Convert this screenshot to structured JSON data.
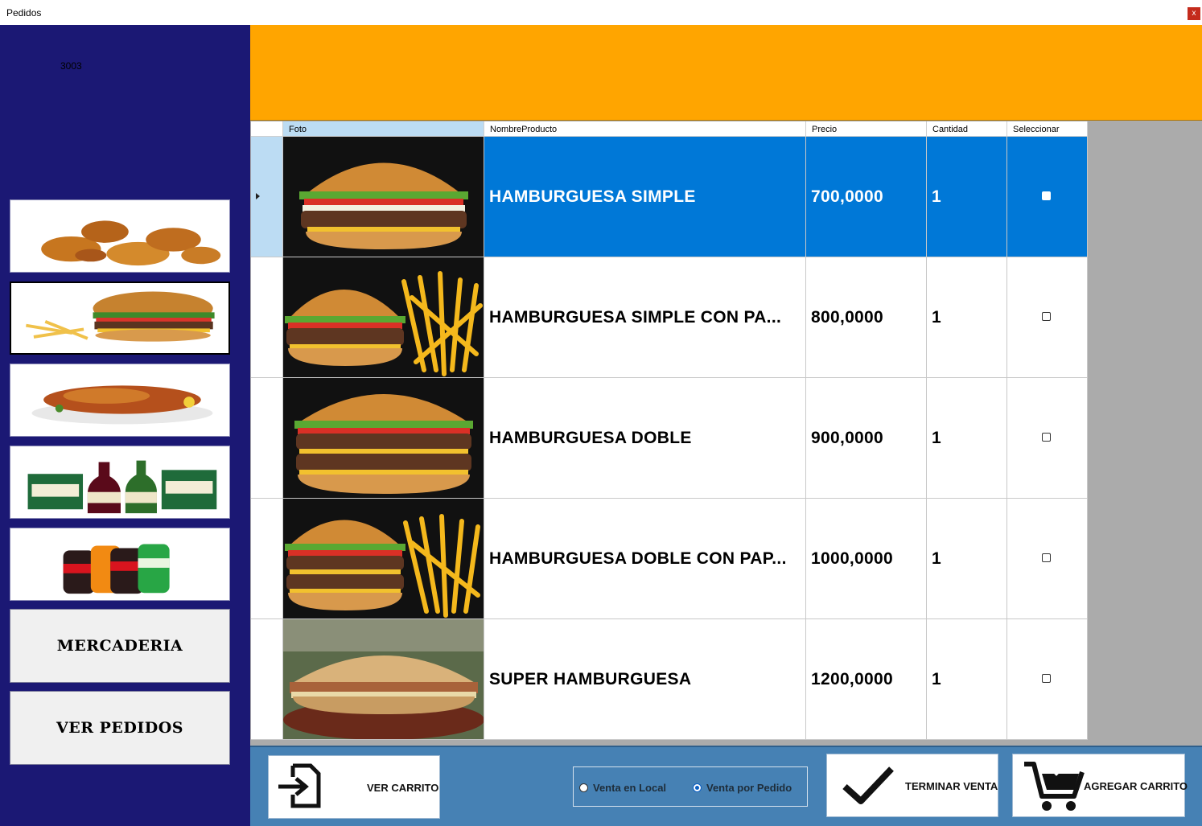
{
  "window": {
    "title": "Pedidos",
    "close_glyph": "x"
  },
  "sidebar": {
    "code": "3003",
    "categories": [
      {
        "icon": "fried-chicken"
      },
      {
        "icon": "burger-and-fries"
      },
      {
        "icon": "roast-meat"
      },
      {
        "icon": "wine"
      },
      {
        "icon": "soda"
      }
    ],
    "mercaderia_label": "MERCADERIA",
    "ver_pedidos_label": "VER PEDIDOS"
  },
  "grid": {
    "columns": [
      "Foto",
      "NombreProducto",
      "Precio",
      "Cantidad",
      "Seleccionar"
    ],
    "rows": [
      {
        "nombre": "HAMBURGUESA SIMPLE",
        "precio": "700,0000",
        "cantidad": "1",
        "photo": "burger-simple"
      },
      {
        "nombre": "HAMBURGUESA SIMPLE CON PA...",
        "precio": "800,0000",
        "cantidad": "1",
        "photo": "burger-with-fries"
      },
      {
        "nombre": "HAMBURGUESA DOBLE",
        "precio": "900,0000",
        "cantidad": "1",
        "photo": "burger-double"
      },
      {
        "nombre": "HAMBURGUESA DOBLE CON PAP...",
        "precio": "1000,0000",
        "cantidad": "1",
        "photo": "burger-double-with-fries"
      },
      {
        "nombre": "SUPER HAMBURGUESA",
        "precio": "1200,0000",
        "cantidad": "1",
        "photo": "super-burger"
      }
    ]
  },
  "footer": {
    "ver_carrito": "VER CARRITO",
    "radio_local": "Venta en Local",
    "radio_pedido": "Venta por Pedido",
    "terminar_venta": "TERMINAR VENTA",
    "agregar_carrito": "AGREGAR CARRITO"
  },
  "colors": {
    "sidebar": "#1b1874",
    "header": "#ffa500",
    "selection": "#0078d7",
    "footer": "#4681b4"
  }
}
